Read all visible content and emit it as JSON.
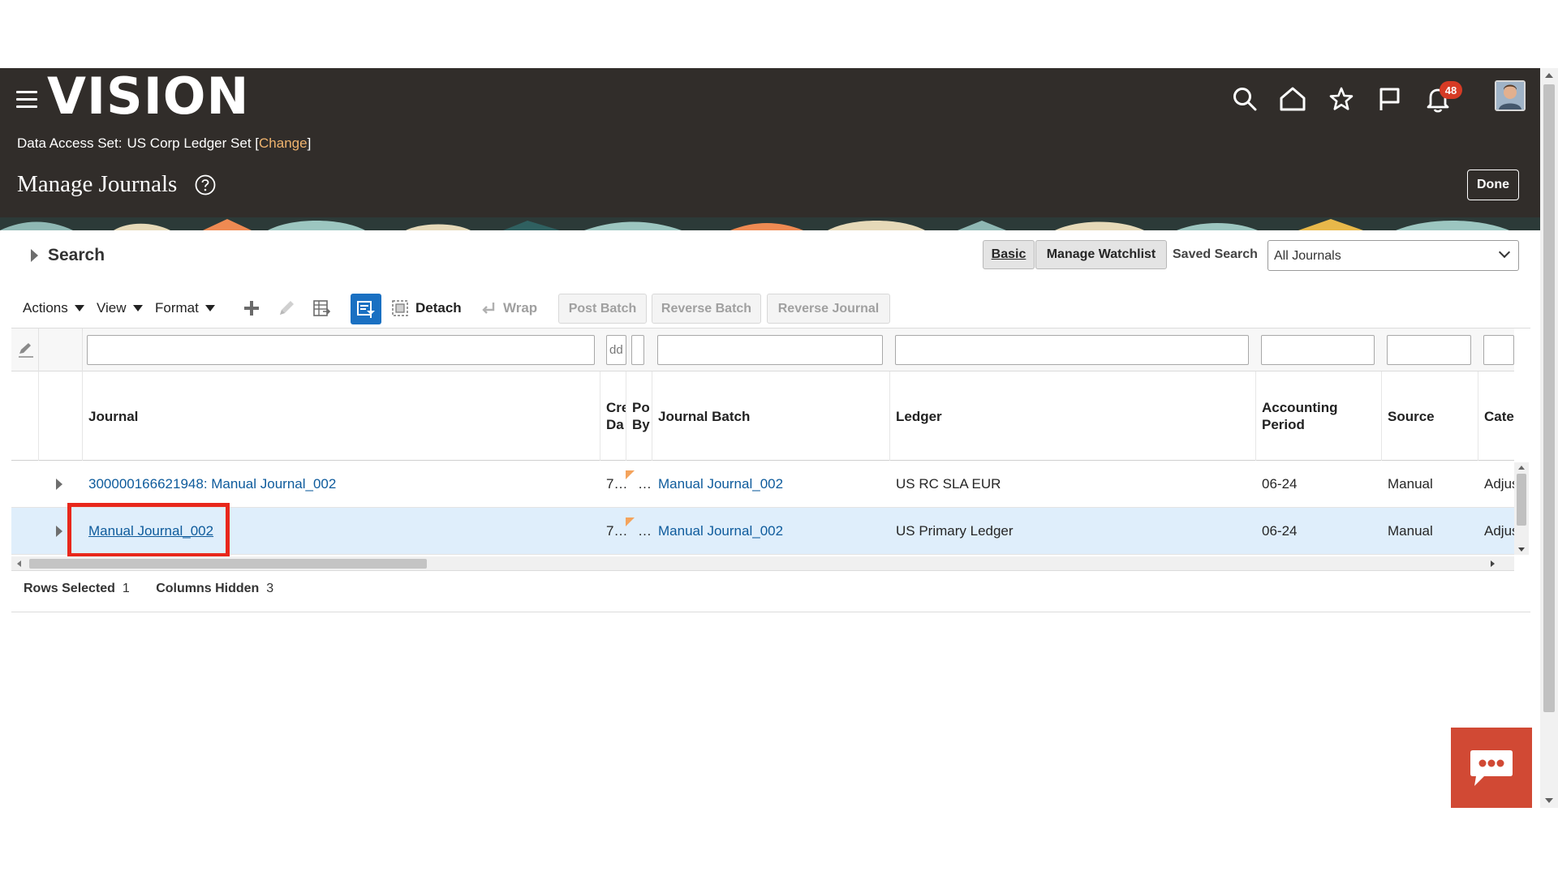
{
  "app": {
    "logo_text": "VISION",
    "data_access_label": "Data Access Set:",
    "data_access_value": "US Corp Ledger Set",
    "change_link": "Change",
    "bracket_open": "[",
    "bracket_close": "]",
    "page_title": "Manage Journals",
    "done_label": "Done",
    "notification_count": "48"
  },
  "search": {
    "toggle_label": "Search",
    "basic_label": "Basic",
    "watchlist_label": "Manage Watchlist",
    "saved_search_label": "Saved Search",
    "saved_search_value": "All Journals"
  },
  "toolbar": {
    "actions": "Actions",
    "view": "View",
    "format": "Format",
    "detach": "Detach",
    "wrap": "Wrap",
    "post_batch": "Post Batch",
    "reverse_batch": "Reverse Batch",
    "reverse_journal": "Reverse Journal"
  },
  "table": {
    "filter_prefill": "dd",
    "columns": {
      "journal": "Journal",
      "created_date_l1": "Cre",
      "created_date_l2": "Da",
      "posted_by_l1": "Po",
      "posted_by_l2": "By",
      "journal_batch": "Journal Batch",
      "ledger": "Ledger",
      "period_l1": "Accounting",
      "period_l2": "Period",
      "source": "Source",
      "category": "Cate"
    },
    "rows": [
      {
        "journal": "300000166621948: Manual Journal_002",
        "created": "7…",
        "posted_by": "…",
        "batch": "Manual Journal_002",
        "ledger": "US RC SLA EUR",
        "period": "06-24",
        "source": "Manual",
        "category": "Adjus"
      },
      {
        "journal": "Manual Journal_002",
        "created": "7…",
        "posted_by": "…",
        "batch": "Manual Journal_002",
        "ledger": "US Primary Ledger",
        "period": "06-24",
        "source": "Manual",
        "category": "Adjus"
      }
    ]
  },
  "status": {
    "rows_selected_label": "Rows Selected",
    "rows_selected_value": "1",
    "columns_hidden_label": "Columns Hidden",
    "columns_hidden_value": "3"
  },
  "colors": {
    "header_bg": "#312d2a",
    "link": "#0e5b9c",
    "selected_row": "#dfeefb",
    "highlight_box": "#e8271b",
    "badge": "#d63b25",
    "chat": "#d14934",
    "qbe_active": "#1a70c2"
  },
  "icons": [
    "menu-icon",
    "search-icon",
    "home-icon",
    "star-icon",
    "flag-icon",
    "bell-icon",
    "help-icon",
    "add-icon",
    "edit-icon",
    "export-icon",
    "query-by-example-icon",
    "detach-icon",
    "wrap-icon",
    "chat-icon"
  ]
}
